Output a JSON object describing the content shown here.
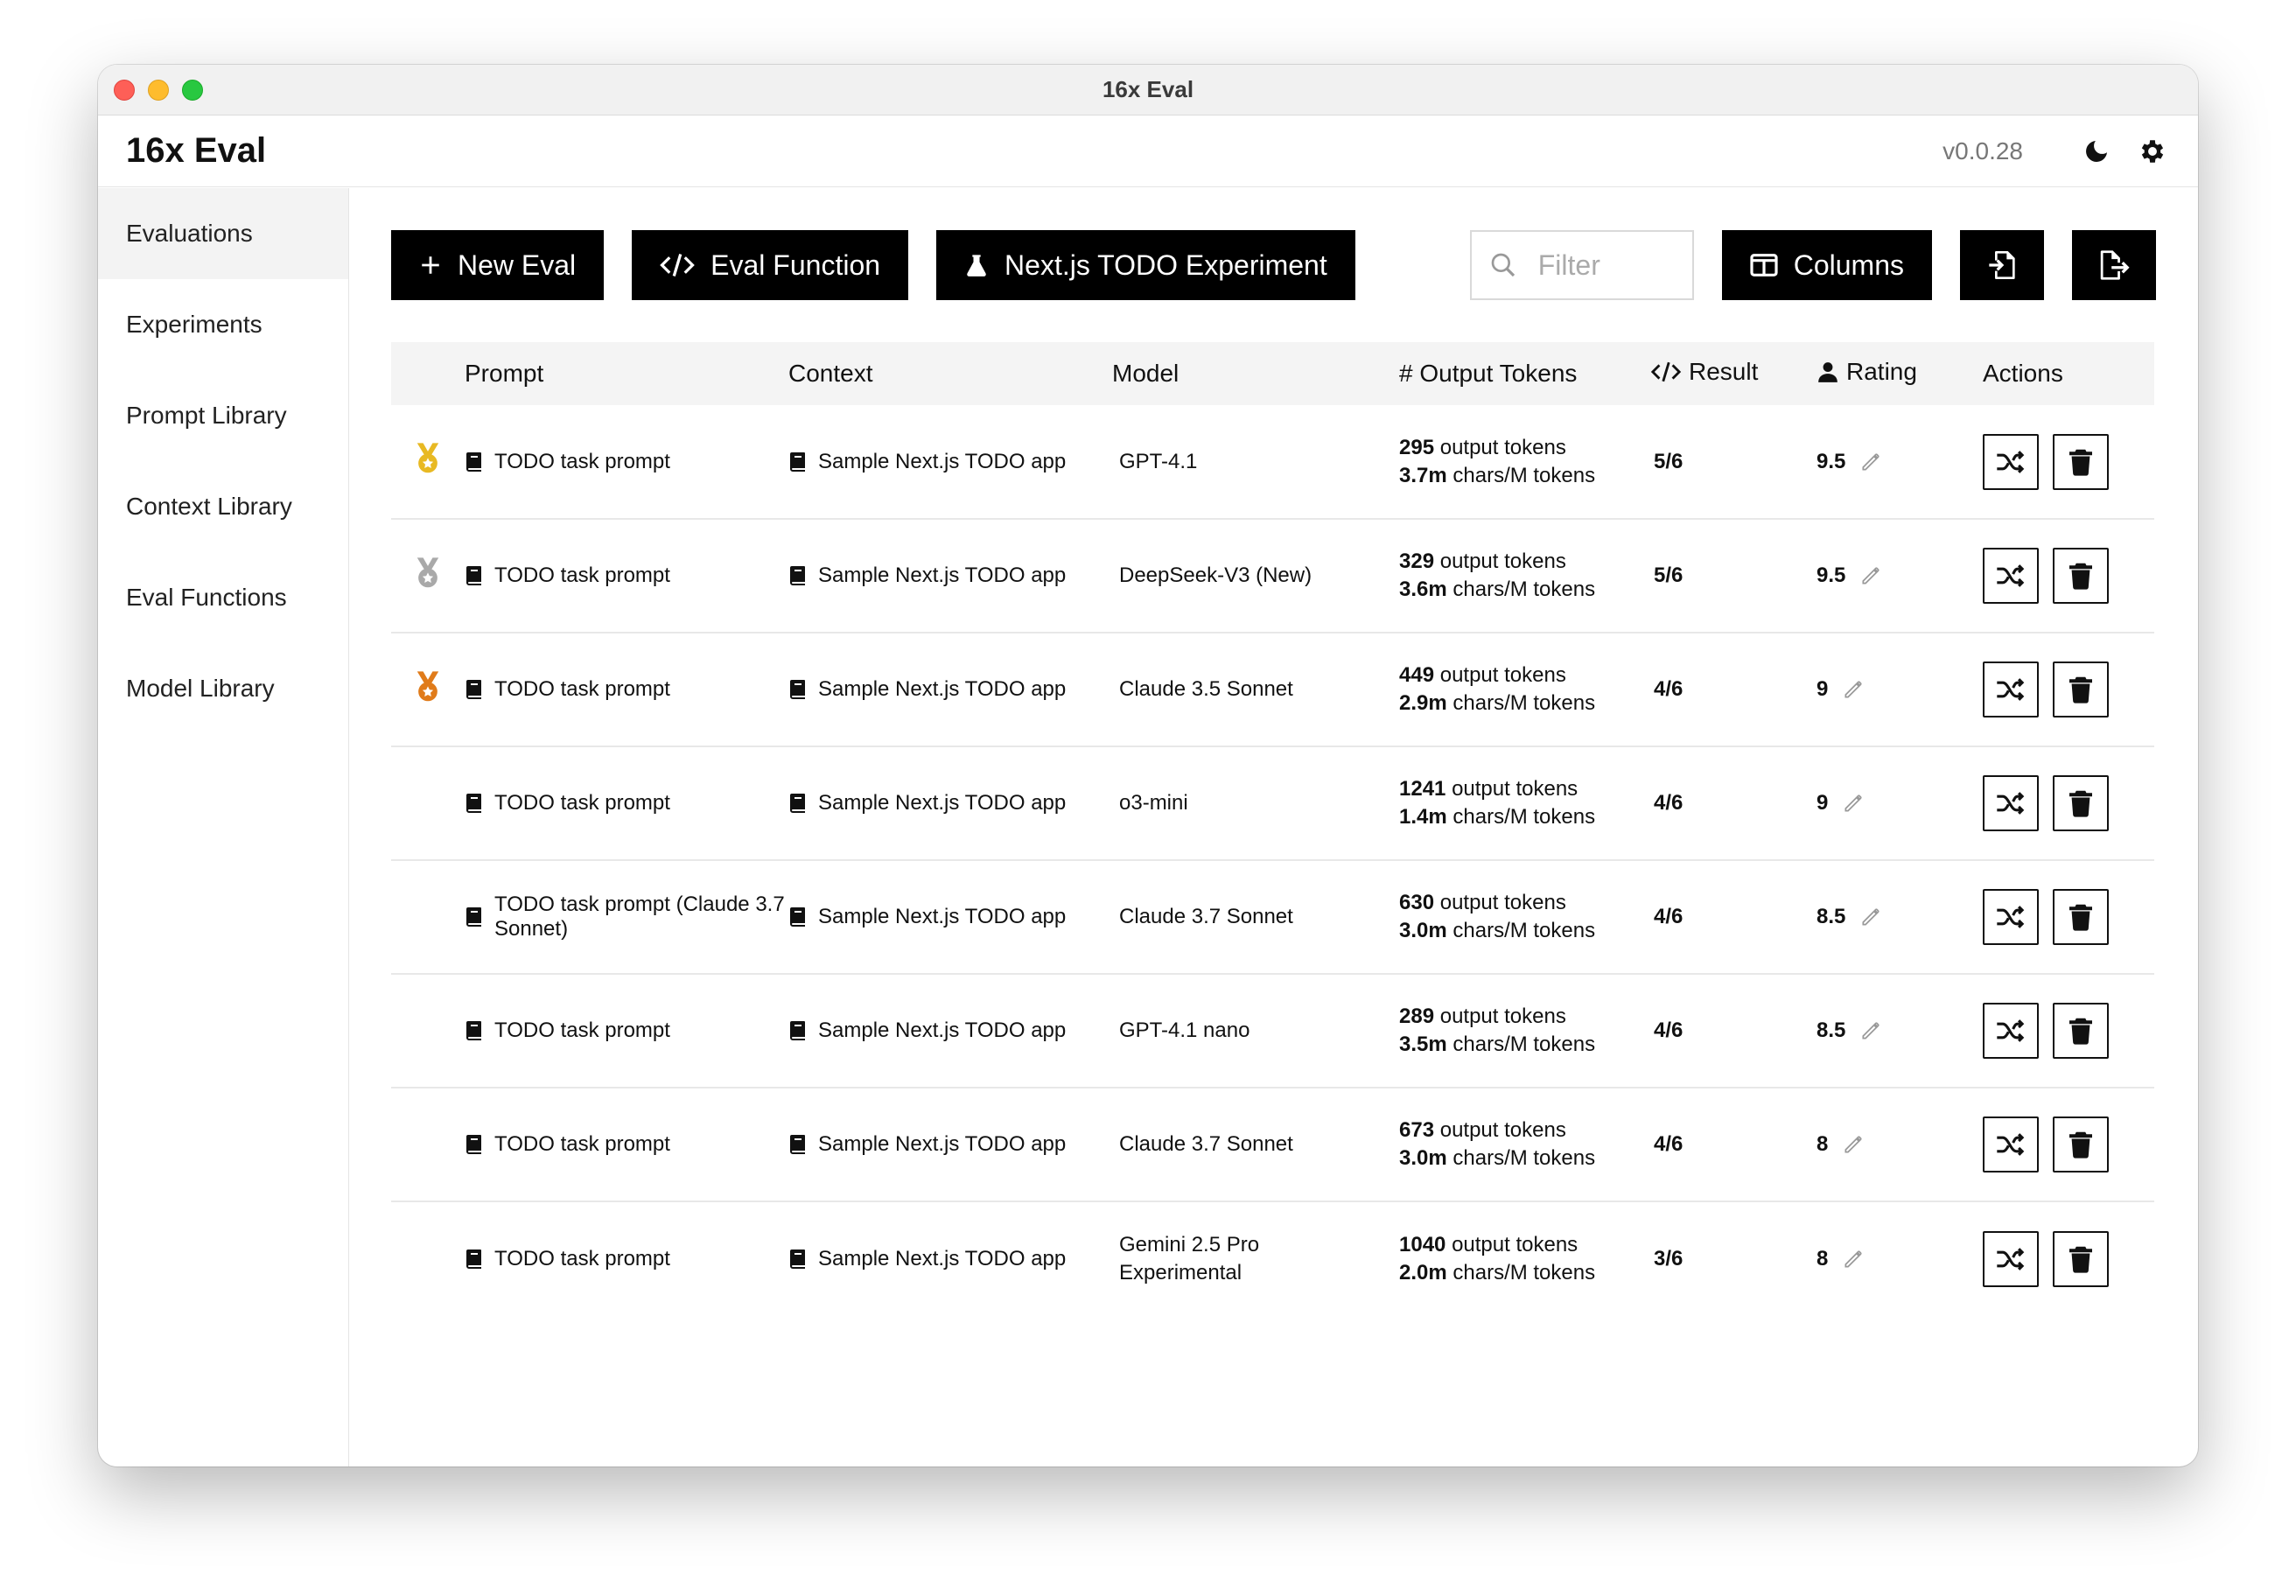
{
  "window": {
    "title": "16x Eval"
  },
  "header": {
    "app_name": "16x Eval",
    "version": "v0.0.28"
  },
  "sidebar": {
    "items": [
      {
        "label": "Evaluations",
        "active": true
      },
      {
        "label": "Experiments",
        "active": false
      },
      {
        "label": "Prompt Library",
        "active": false
      },
      {
        "label": "Context Library",
        "active": false
      },
      {
        "label": "Eval Functions",
        "active": false
      },
      {
        "label": "Model Library",
        "active": false
      }
    ]
  },
  "toolbar": {
    "new_eval": "New Eval",
    "eval_function": "Eval Function",
    "experiment": "Next.js TODO Experiment",
    "filter_placeholder": "Filter",
    "columns": "Columns"
  },
  "table": {
    "headers": {
      "prompt": "Prompt",
      "context": "Context",
      "model": "Model",
      "output_tokens": "# Output Tokens",
      "result": "Result",
      "rating": "Rating",
      "actions": "Actions"
    },
    "token_suffix": "output tokens",
    "chars_suffix": "chars/M tokens",
    "rows": [
      {
        "medal": "gold",
        "prompt": "TODO task prompt",
        "context": "Sample Next.js TODO app",
        "model": "GPT-4.1",
        "tokens": "295",
        "chars": "3.7m",
        "result": "5/6",
        "rating": "9.5"
      },
      {
        "medal": "silver",
        "prompt": "TODO task prompt",
        "context": "Sample Next.js TODO app",
        "model": "DeepSeek-V3 (New)",
        "tokens": "329",
        "chars": "3.6m",
        "result": "5/6",
        "rating": "9.5"
      },
      {
        "medal": "bronze",
        "prompt": "TODO task prompt",
        "context": "Sample Next.js TODO app",
        "model": "Claude 3.5 Sonnet",
        "tokens": "449",
        "chars": "2.9m",
        "result": "4/6",
        "rating": "9"
      },
      {
        "medal": "",
        "prompt": "TODO task prompt",
        "context": "Sample Next.js TODO app",
        "model": "o3-mini",
        "tokens": "1241",
        "chars": "1.4m",
        "result": "4/6",
        "rating": "9"
      },
      {
        "medal": "",
        "prompt": "TODO task prompt (Claude 3.7 Sonnet)",
        "context": "Sample Next.js TODO app",
        "model": "Claude 3.7 Sonnet",
        "tokens": "630",
        "chars": "3.0m",
        "result": "4/6",
        "rating": "8.5"
      },
      {
        "medal": "",
        "prompt": "TODO task prompt",
        "context": "Sample Next.js TODO app",
        "model": "GPT-4.1 nano",
        "tokens": "289",
        "chars": "3.5m",
        "result": "4/6",
        "rating": "8.5"
      },
      {
        "medal": "",
        "prompt": "TODO task prompt",
        "context": "Sample Next.js TODO app",
        "model": "Claude 3.7 Sonnet",
        "tokens": "673",
        "chars": "3.0m",
        "result": "4/6",
        "rating": "8"
      },
      {
        "medal": "",
        "prompt": "TODO task prompt",
        "context": "Sample Next.js TODO app",
        "model": "Gemini 2.5 Pro Experimental",
        "tokens": "1040",
        "chars": "2.0m",
        "result": "3/6",
        "rating": "8"
      }
    ]
  },
  "colors": {
    "gold": "#e8b923",
    "silver": "#a9a9a9",
    "bronze": "#e07b1a",
    "button_bg": "#000000"
  }
}
